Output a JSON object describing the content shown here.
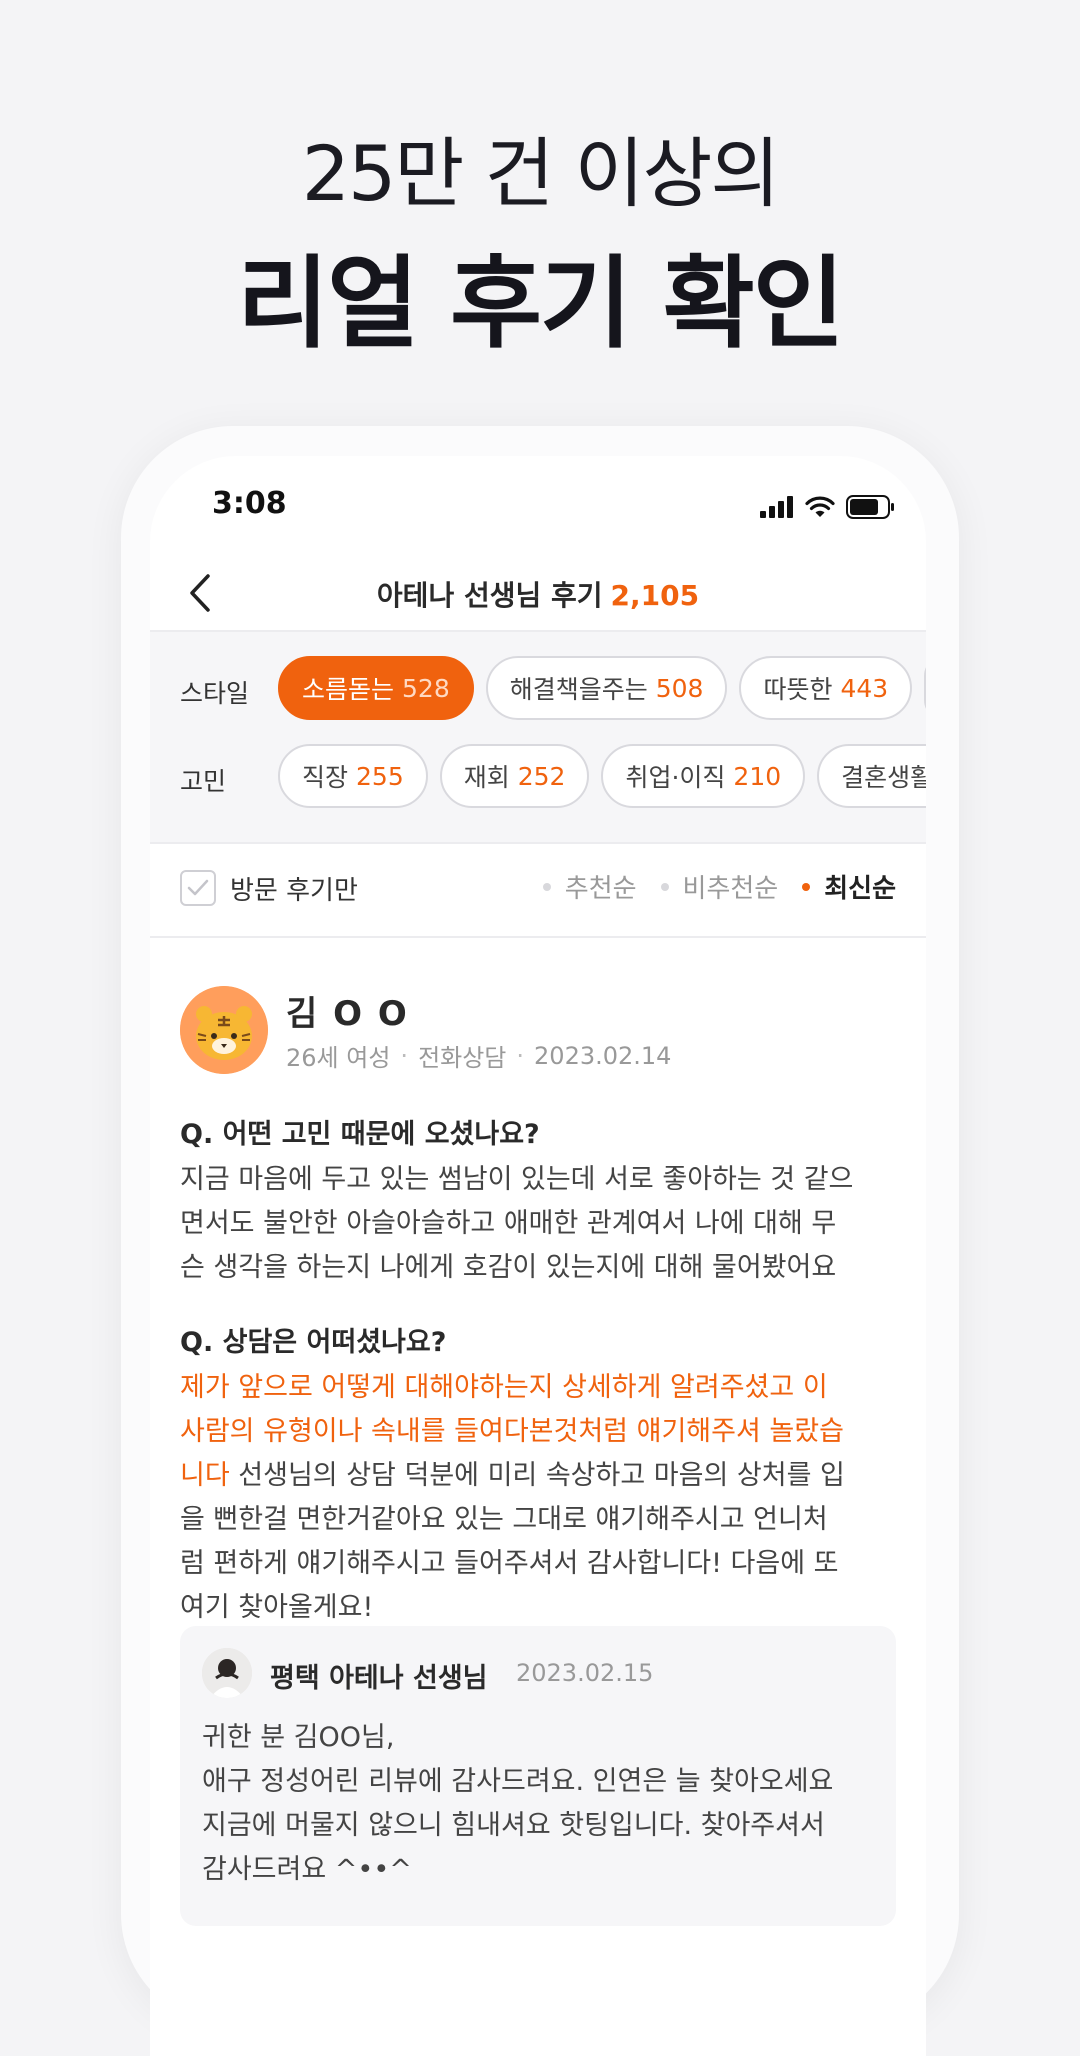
{
  "headline": {
    "line1": "25만 건 이상의",
    "line2": "리얼 후기 확인"
  },
  "status_bar": {
    "time": "3:08"
  },
  "nav": {
    "title": "아테나 선생님 후기",
    "count": "2,105"
  },
  "filters": {
    "style": {
      "label": "스타일",
      "chips": [
        {
          "label": "소름돋는",
          "count": "528",
          "active": true
        },
        {
          "label": "해결책을주는",
          "count": "508",
          "active": false
        },
        {
          "label": "따뜻한",
          "count": "443",
          "active": false
        }
      ]
    },
    "concern": {
      "label": "고민",
      "chips": [
        {
          "label": "직장",
          "count": "255"
        },
        {
          "label": "재회",
          "count": "252"
        },
        {
          "label": "취업·이직",
          "count": "210"
        },
        {
          "label": "결혼생활",
          "count": ""
        }
      ]
    }
  },
  "sortbar": {
    "visit_only_label": "방문 후기만",
    "options": [
      "추천순",
      "비추천순",
      "최신순"
    ],
    "active": "최신순"
  },
  "review": {
    "name": "김 O O",
    "age_gender": "26세 여성",
    "type": "전화상담",
    "date": "2023.02.14",
    "q1": "Q. 어떤 고민 때문에 오셨나요?",
    "a1_lines": [
      "지금 마음에 두고 있는 썸남이 있는데 서로 좋아하는 것 같으",
      "면서도 불안한 아슬아슬하고 애매한 관계여서 나에 대해 무",
      "슨 생각을 하는지 나에게 호감이 있는지에 대해 물어봤어요"
    ],
    "q2": "Q. 상담은 어떠셨나요?",
    "a2_highlight_lines": [
      "제가 앞으로 어떻게 대해야하는지 상세하게 알려주셨고 이",
      "사람의 유형이나 속내를 들여다본것처럼 얘기해주셔 놀랐습",
      "니다"
    ],
    "a2_rest_first": " 선생님의 상담 덕분에 미리 속상하고 마음의 상처를 입",
    "a2_lines": [
      "을 뻔한걸 면한거같아요 있는 그대로 얘기해주시고 언니처",
      "럼 편하게 얘기해주시고 들어주셔서 감사합니다! 다음에 또",
      "여기 찾아올게요!"
    ],
    "reply": {
      "name": "평택 아테나 선생님",
      "date": "2023.02.15",
      "lines": [
        "귀한 분 김OO님,",
        "애구 정성어린 리뷰에 감사드려요. 인연은 늘 찾아오세요",
        "지금에 머물지 않으니 힘내셔요 핫팅입니다. 찾아주셔서",
        "감사드려요 ^••^"
      ]
    }
  },
  "colors": {
    "accent": "#f0620e",
    "background": "#f4f4f6"
  },
  "icons": [
    "back-chevron-icon",
    "signal-icon",
    "wifi-icon",
    "battery-icon",
    "check-icon",
    "tiger-avatar-icon"
  ]
}
